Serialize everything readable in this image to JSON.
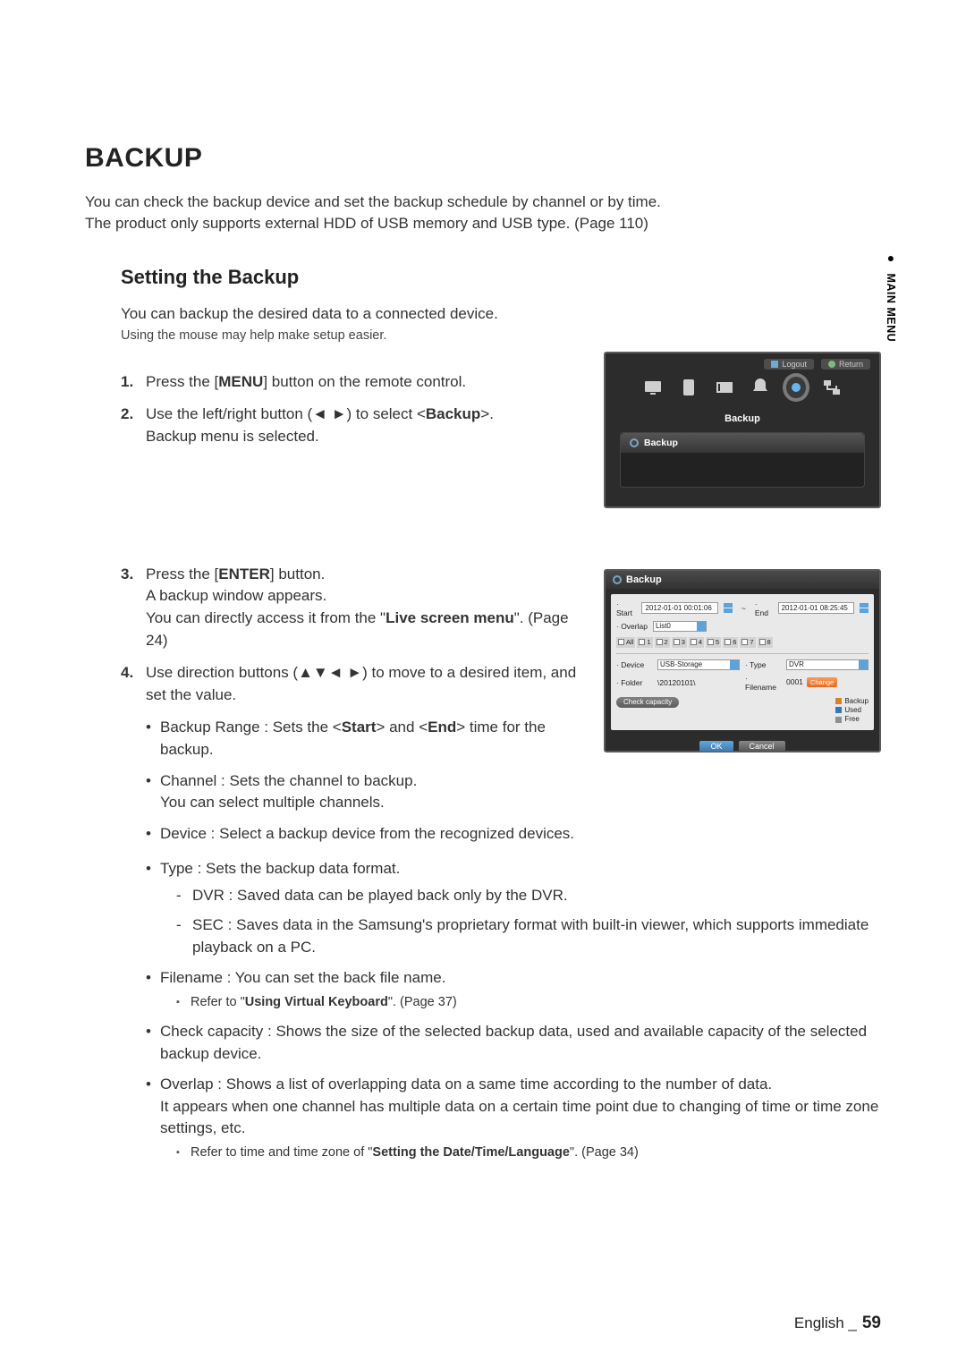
{
  "sideTab": "MAIN MENU",
  "heading": "BACKUP",
  "intro": [
    "You can check the backup device and set the backup schedule by channel or by time.",
    "The product only supports external HDD of USB memory and USB type. (Page 110)"
  ],
  "sub": "Setting the Backup",
  "desc": "You can backup the desired data to a connected device.",
  "hint": "Using the mouse may help make setup easier.",
  "steps12": [
    {
      "n": "1.",
      "pre": "Press the [",
      "bold": "MENU",
      "post": "] button on the remote control."
    },
    {
      "n": "2.",
      "pre": "Use the left/right button (◄ ►) to select <",
      "bold": "Backup",
      "post": ">.",
      "sub": "Backup menu is selected."
    }
  ],
  "steps34": [
    {
      "n": "3.",
      "pre": "Press the [",
      "bold": "ENTER",
      "post": "] button.",
      "sub": "A backup window appears.",
      "sub2pre": "You can directly access it from the \"",
      "sub2bold": "Live screen menu",
      "sub2post": "\". (Page 24)"
    },
    {
      "n": "4.",
      "text": "Use direction buttons (▲▼◄ ►) to move to a desired item, and set the value."
    }
  ],
  "bullets_a": [
    {
      "pre": "Backup Range : Sets the <",
      "b1": "Start",
      "mid": "> and <",
      "b2": "End",
      "post": "> time for the backup."
    },
    {
      "text": "Channel : Sets the channel to backup.",
      "sub": "You can select multiple channels."
    },
    {
      "text": "Device : Select a backup device from the recognized devices."
    },
    {
      "text": "Type : Sets the backup data format.",
      "dash": [
        "DVR : Saved data can be played back only by the DVR.",
        "SEC : Saves data in the Samsung's proprietary format with built-in viewer, which supports immediate playback on a PC."
      ]
    },
    {
      "text": "Filename : You can set the back file name.",
      "note_pre": "Refer to \"",
      "note_bold": "Using Virtual Keyboard",
      "note_post": "\". (Page 37)"
    },
    {
      "text": "Check capacity : Shows the size of the selected backup data, used and available capacity of the selected backup device."
    },
    {
      "text": "Overlap : Shows a list of overlapping data on a same time according to the number of data.",
      "sub": "It appears when one channel has multiple data on a certain time point due to changing of time or time zone settings, etc.",
      "note_pre": "Refer to time and time zone of \"",
      "note_bold": "Setting the Date/Time/Language",
      "note_post": "\". (Page 34)"
    }
  ],
  "scr1": {
    "logout": "Logout",
    "return": "Return",
    "title": "Backup",
    "menuItem": "Backup"
  },
  "scr2": {
    "title": "Backup",
    "labels": {
      "start": "· Start",
      "end": "· End",
      "overlap": "· Overlap",
      "device": "· Device",
      "folder": "· Folder",
      "type": "· Type",
      "filename": "· Filename"
    },
    "startVal": "2012-01-01 00:01:06",
    "endVal": "2012-01-01 08:25:45",
    "overlapVal": "List0",
    "channels": [
      "All",
      "1",
      "2",
      "3",
      "4",
      "5",
      "6",
      "7",
      "8"
    ],
    "deviceVal": "USB-Storage",
    "folderVal": "\\20120101\\",
    "typeVal": "DVR",
    "filenameVal": "0001",
    "change": "Change",
    "check": "Check capacity",
    "legend": {
      "backup": "Backup",
      "used": "Used",
      "free": "Free"
    },
    "ok": "OK",
    "cancel": "Cancel"
  },
  "footer": {
    "lang": "English",
    "page": "59"
  }
}
